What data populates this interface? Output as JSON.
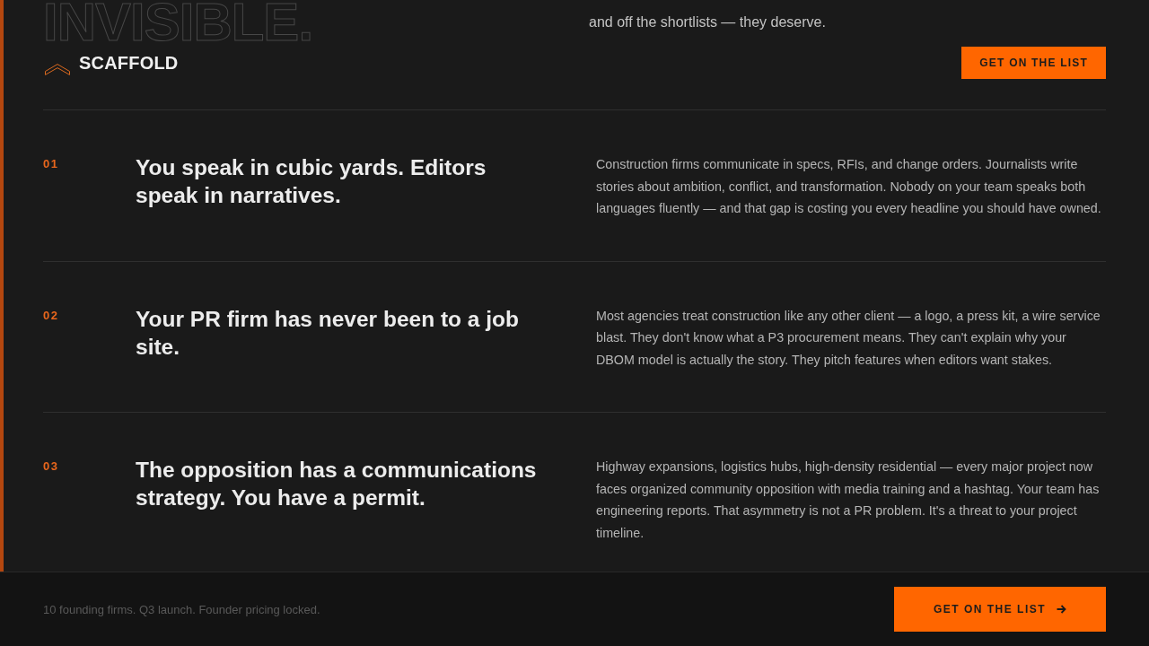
{
  "hero": {
    "headline_fragment": "INVISIBLE.",
    "text_fragment": "and off the shortlists — they deserve."
  },
  "header": {
    "logo": "SCAFFOLD",
    "cta": "GET ON THE LIST"
  },
  "problems": [
    {
      "number": "01",
      "title": "You speak in cubic yards. Editors speak in narratives.",
      "body": "Construction firms communicate in specs, RFIs, and change orders. Journalists write stories about ambition, conflict, and transformation. Nobody on your team speaks both languages fluently — and that gap is costing you every headline you should have owned."
    },
    {
      "number": "02",
      "title": "Your PR firm has never been to a job site.",
      "body": "Most agencies treat construction like any other client — a logo, a press kit, a wire service blast. They don't know what a P3 procurement means. They can't explain why your DBOM model is actually the story. They pitch features when editors want stakes."
    },
    {
      "number": "03",
      "title": "The opposition has a communications strategy. You have a permit.",
      "body": "Highway expansions, logistics hubs, high-density residential — every major project now faces organized community opposition with media training and a hashtag. Your team has engineering reports. That asymmetry is not a PR problem. It's a threat to your project timeline."
    }
  ],
  "footer": {
    "note": "10 founding firms. Q3 launch. Founder pricing locked.",
    "cta": "GET ON THE LIST"
  }
}
